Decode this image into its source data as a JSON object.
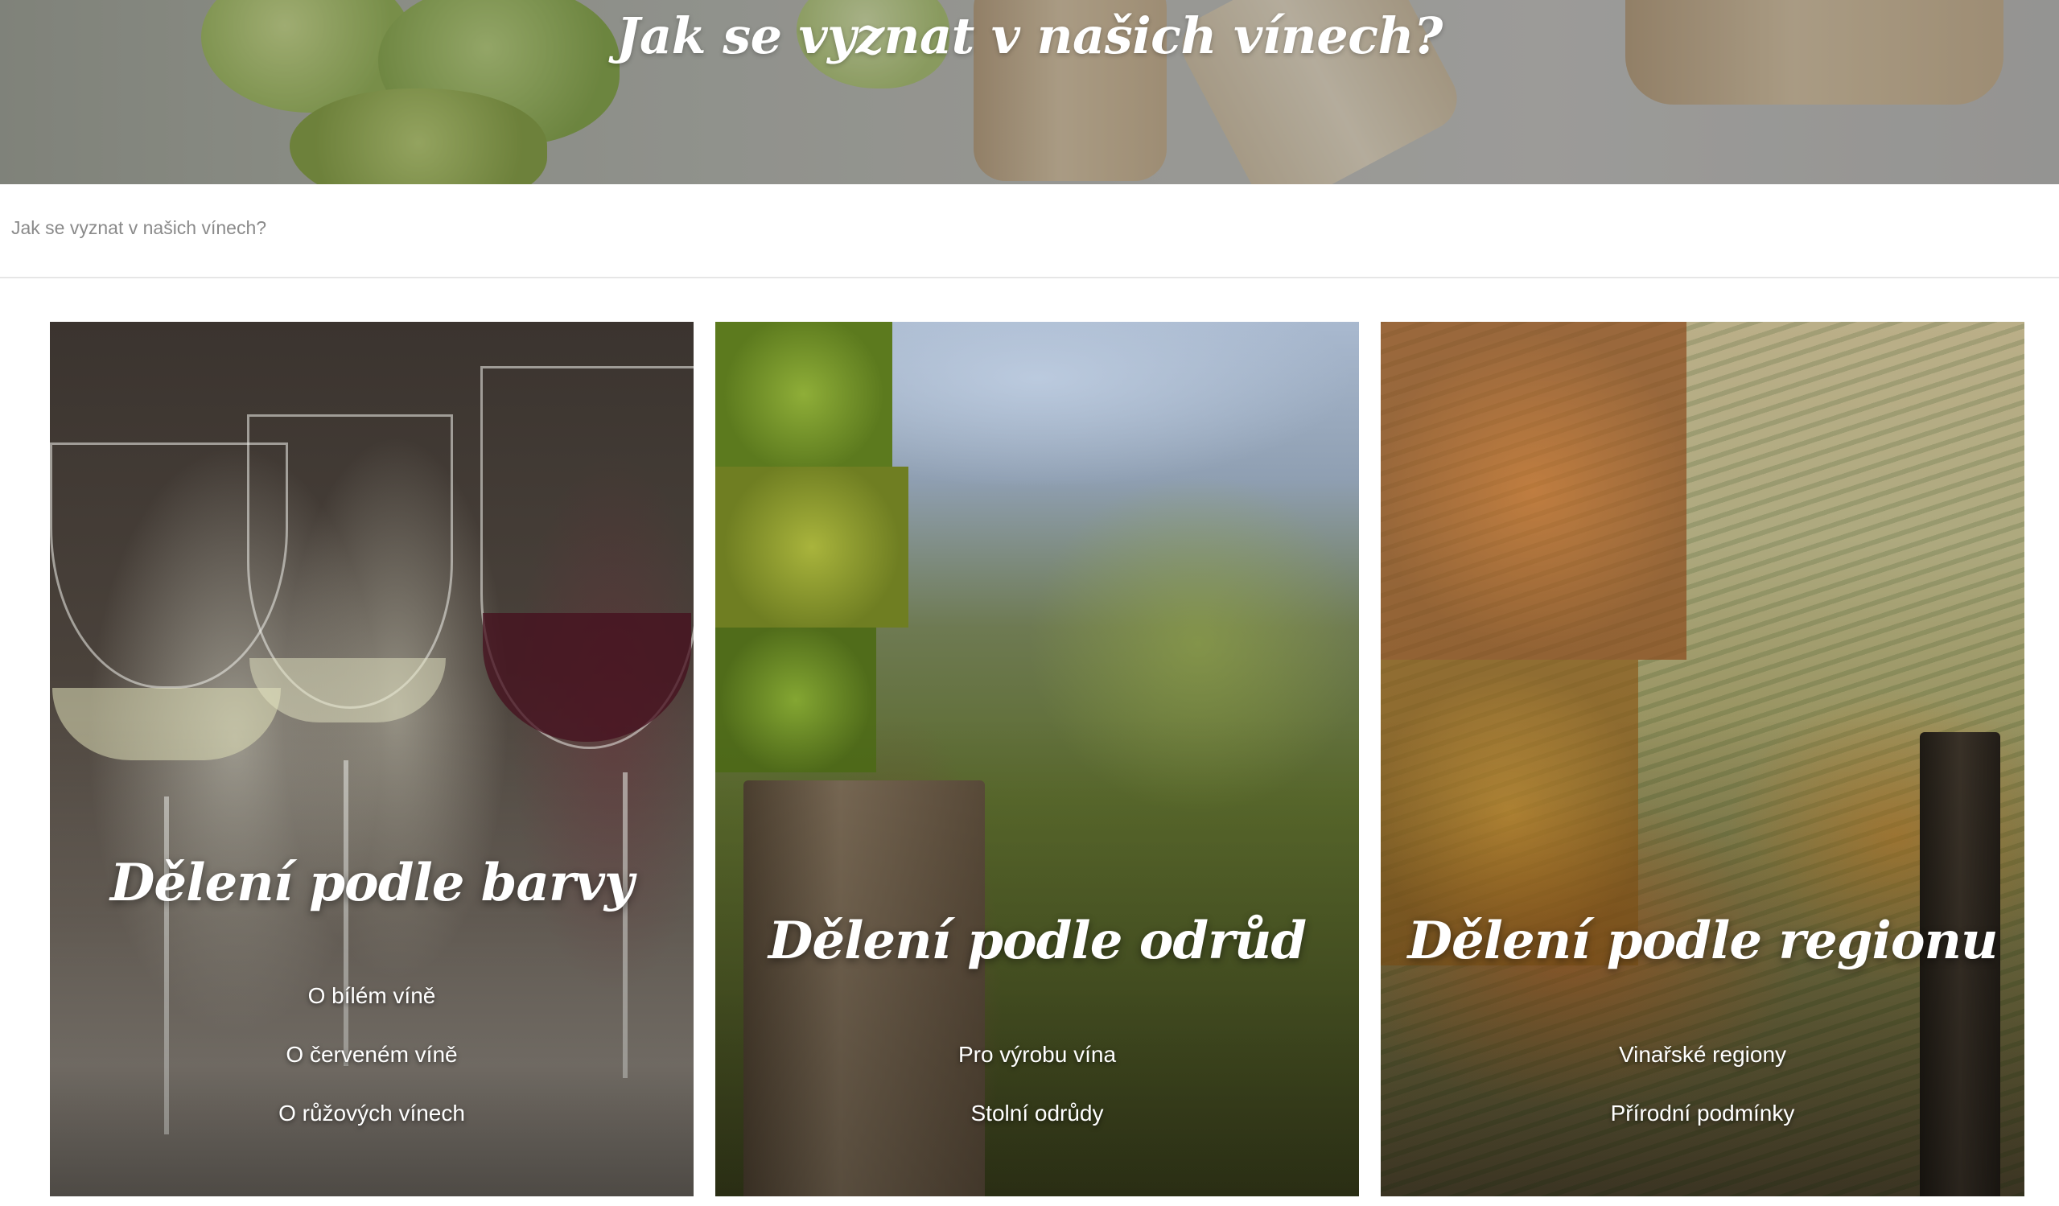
{
  "hero": {
    "title": "Jak se vyznat v našich vínech?"
  },
  "breadcrumb": {
    "current": "Jak se vyznat v našich vínech?"
  },
  "cards": [
    {
      "title": "Dělení podle barvy",
      "links": [
        "O bílém víně",
        "O červeném víně",
        "O růžových vínech"
      ]
    },
    {
      "title": "Dělení podle odrůd",
      "links": [
        "Pro výrobu vína",
        "Stolní odrůdy"
      ]
    },
    {
      "title": "Dělení podle regionu",
      "links": [
        "Vinařské regiony",
        "Přírodní podmínky"
      ]
    }
  ],
  "colors": {
    "text_on_image": "#ffffff",
    "breadcrumb_text": "#8a8a8a",
    "divider": "#e6e6e6"
  }
}
